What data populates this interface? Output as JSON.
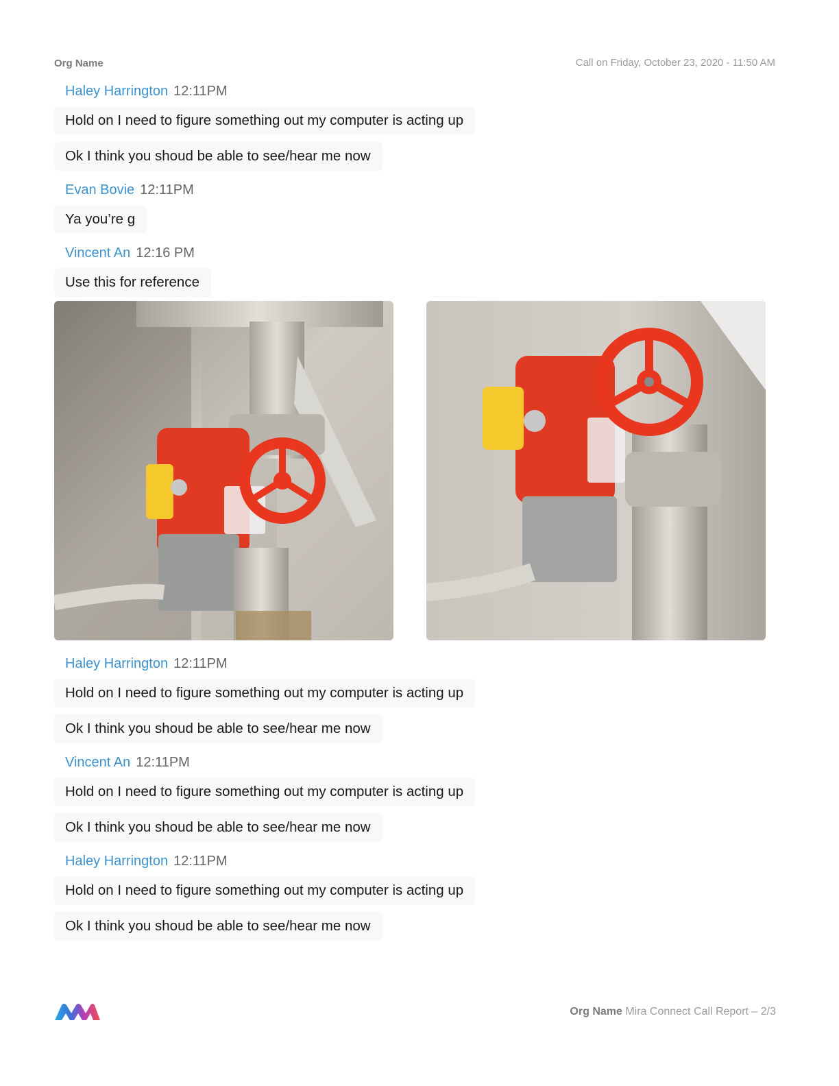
{
  "header": {
    "org": "Org Name",
    "call_info": "Call on Friday, October 23, 2020 - 11:50 AM"
  },
  "groups": [
    {
      "name": "Haley Harrington",
      "time": "12:11PM",
      "messages": [
        "Hold on I need to figure something out my computer is acting up",
        "Ok I think you shoud be able to see/hear me now"
      ]
    },
    {
      "name": "Evan Bovie",
      "time": "12:11PM",
      "messages": [
        "Ya you’re g"
      ]
    },
    {
      "name": "Vincent An",
      "time": "12:16 PM",
      "messages": [
        "Use this for reference"
      ]
    },
    {
      "name": "Haley Harrington",
      "time": "12:11PM",
      "messages": [
        "Hold on I need to figure something out my computer is acting up",
        "Ok I think you shoud be able to see/hear me now"
      ]
    },
    {
      "name": "Vincent An",
      "time": "12:11PM",
      "messages": [
        "Hold on I need to figure something out my computer is acting up",
        "Ok I think you shoud be able to see/hear me now"
      ]
    },
    {
      "name": "Haley Harrington",
      "time": "12:11PM",
      "messages": [
        "Hold on I need to figure something out my computer is acting up",
        "Ok I think you shoud be able to see/hear me now"
      ]
    }
  ],
  "attachments": [
    "valve-photo-1",
    "valve-photo-2"
  ],
  "footer": {
    "org": "Org Name",
    "report": "Mira Connect Call Report – 2/3"
  },
  "colors": {
    "sender": "#3d92cc",
    "bubble": "#f6f8fa",
    "valve_red": "#e8361f",
    "tab_yellow": "#f5c92c"
  }
}
